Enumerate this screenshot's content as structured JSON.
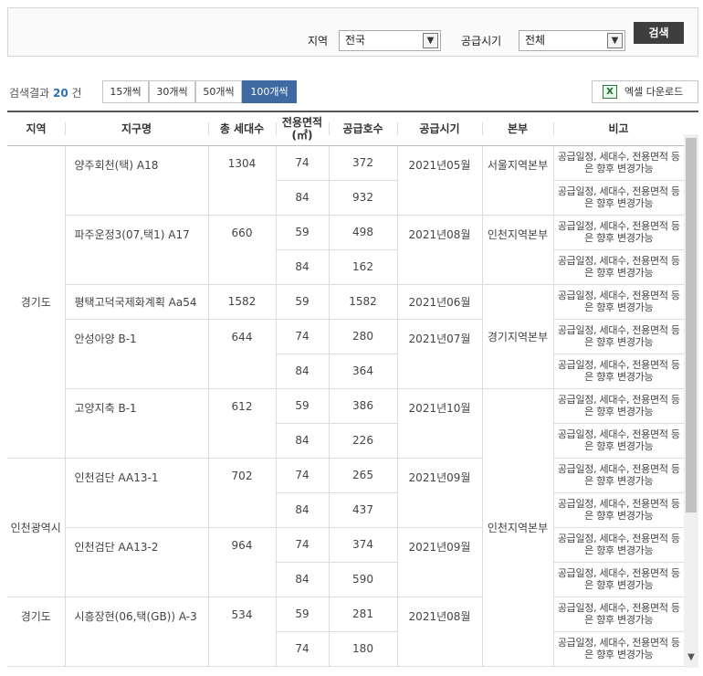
{
  "search": {
    "region_label": "지역",
    "region_value": "전국",
    "period_label": "공급시기",
    "period_value": "전체",
    "button": "검색"
  },
  "results": {
    "prefix": "검색결과",
    "count": "20",
    "suffix": "건",
    "page_sizes": [
      "15개씩",
      "30개씩",
      "50개씩",
      "100개씩"
    ],
    "excel_label": "엑셀 다운로드"
  },
  "table": {
    "headers": [
      "지역",
      "지구명",
      "총 세대수",
      "전용면적(㎡)",
      "공급호수",
      "공급시기",
      "본부",
      "비고"
    ],
    "note": "공급일정, 세대수, 전용면적 등은 향후 변경가능",
    "cells": {
      "r0_region": "경기도",
      "r0_name": "양주회천(택) A18",
      "r0_total": "1304",
      "r0_area1": "74",
      "r0_units1": "372",
      "r0_area2": "84",
      "r0_units2": "932",
      "r0_time": "2021년05월",
      "r0_hq": "서울지역본부",
      "r1_name": "파주운정3(07,택1) A17",
      "r1_total": "660",
      "r1_area1": "59",
      "r1_units1": "498",
      "r1_area2": "84",
      "r1_units2": "162",
      "r1_time": "2021년08월",
      "r1_hq": "인천지역본부",
      "r2_name": "평택고덕국제화계획 Aa54",
      "r2_total": "1582",
      "r2_area1": "59",
      "r2_units1": "1582",
      "r2_time": "2021년06월",
      "r2_hq": "경기지역본부",
      "r3_name": "안성아양 B-1",
      "r3_total": "644",
      "r3_area1": "74",
      "r3_units1": "280",
      "r3_area2": "84",
      "r3_units2": "364",
      "r3_time": "2021년07월",
      "r4_name": "고양지축 B-1",
      "r4_total": "612",
      "r4_area1": "59",
      "r4_units1": "386",
      "r4_area2": "84",
      "r4_units2": "226",
      "r4_time": "2021년10월",
      "r5_region": "인천광역시",
      "r5_name": "인천검단 AA13-1",
      "r5_total": "702",
      "r5_area1": "74",
      "r5_units1": "265",
      "r5_area2": "84",
      "r5_units2": "437",
      "r5_time": "2021년09월",
      "r5_hq": "인천지역본부",
      "r6_name": "인천검단 AA13-2",
      "r6_total": "964",
      "r6_area1": "74",
      "r6_units1": "374",
      "r6_area2": "84",
      "r6_units2": "590",
      "r6_time": "2021년09월",
      "r7_region": "경기도",
      "r7_name": "시흥장현(06,택(GB)) A-3",
      "r7_total": "534",
      "r7_area1": "59",
      "r7_units1": "281",
      "r7_area2": "74",
      "r7_units2": "180",
      "r7_time": "2021년08월"
    }
  }
}
